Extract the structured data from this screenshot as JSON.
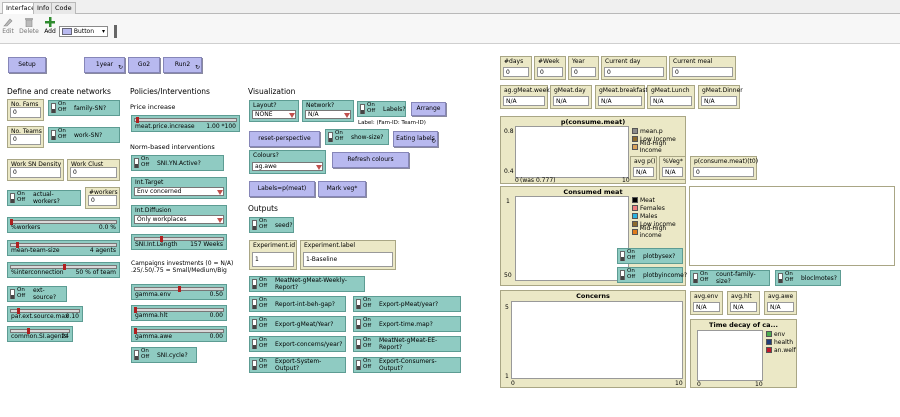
{
  "tabs": [
    "Interface",
    "Info",
    "Code"
  ],
  "toolbar": {
    "edit": "Edit",
    "delete": "Delete",
    "add": "Add",
    "widget_type": "Button"
  },
  "buttons": {
    "setup": "Setup",
    "one_year": "1year",
    "go2": "Go2",
    "run2": "Run2",
    "arrange": "Arrange",
    "reset_perspective": "reset-perspective",
    "eating_labels": "Eating labels",
    "refresh_colours": "Refresh colours",
    "labels_meat": "Labels=p(meat)",
    "mark_veg": "Mark veg*"
  },
  "sections": {
    "networks": "Define and create networks",
    "policies": "Policies/Interventions",
    "visualization": "Visualization",
    "outputs": "Outputs",
    "price_increase": "Price increase",
    "norm_based": "Norm-based interventions",
    "campaigns_line1": "Campaigns investments (0 = N/A)",
    "campaigns_line2": ".25/.50/.75 = Small/Medium/Big",
    "label_hint": "Label: (Fam-ID: Team-ID)"
  },
  "switches": {
    "family_sn": "family-SN?",
    "work_sn": "work-SN?",
    "actual_workers": "actual-workers?",
    "ext_source": "ext-source?",
    "sni_yn_active": "SNI.YN.Active?",
    "sni_cycle": "SNI.cycle?",
    "labels": "Labels?",
    "show_size": "show-size?",
    "seed": "seed?",
    "meatnet_weekly": "MeatNet-gMeat-Weekly-Report?",
    "report_int_beh_gap": "Report-int-beh-gap?",
    "export_gmeat_year": "Export-gMeat/Year?",
    "export_concerns_year": "Export-concerns/year?",
    "export_system_output": "Export-System-Output?",
    "export_pmeat_year": "Export-pMeat/year?",
    "export_time_map": "Export-time.map?",
    "meatnet_ee_report": "MeatNet-gMeat-EE-Report?",
    "export_consumers_output": "Export-Consumers-Output?",
    "plotbysex": "plotbysex?",
    "plotbyincome": "plotbyincome?",
    "count_family_size": "count-family-size?",
    "bloclmotes": "bloclmotes?",
    "on": "On",
    "off": "Off"
  },
  "inputs": {
    "no_fams": {
      "label": "No. Fams",
      "value": "0"
    },
    "no_teams": {
      "label": "No. Teams",
      "value": "0"
    },
    "work_sn_density": {
      "label": "Work SN Density",
      "value": "0"
    },
    "work_clust_coeff": {
      "label": "Work Clust Coeff",
      "value": "0"
    },
    "n_workers": {
      "label": "#workers",
      "value": "0"
    },
    "experiment_id": {
      "label": "Experiment.id",
      "value": "1"
    },
    "experiment_label": {
      "label": "Experiment.label",
      "value": "1-Baseline"
    }
  },
  "sliders": {
    "pct_workers": {
      "name": "%workers",
      "value": "0.0 %",
      "fraction": 0.0
    },
    "mean_team_size": {
      "name": "mean-team-size",
      "value": "4 agents",
      "fraction": 0.06
    },
    "pct_interconnection": {
      "name": "%interconnection",
      "value": "50 % of team",
      "fraction": 0.5
    },
    "par_ext_source_max": {
      "name": "par.ext.source.max",
      "value": "0.10",
      "fraction": 0.1
    },
    "common_si_agents": {
      "name": "common.SI.agents",
      "value": "24",
      "fraction": 0.3
    },
    "meat_price_increase": {
      "name": "meat.price.increase",
      "value": "1.00 *100",
      "fraction": 0.02
    },
    "sni_int_length": {
      "name": "SNI.Int.Length",
      "value": "157 Weeks",
      "fraction": 0.3
    },
    "gamma_env": {
      "name": "gamma.env",
      "value": "0.50",
      "fraction": 0.5
    },
    "gamma_hlt": {
      "name": "gamma.hlt",
      "value": "0.00",
      "fraction": 0.0
    },
    "gamma_awe": {
      "name": "gamma.awe",
      "value": "0.00",
      "fraction": 0.0
    }
  },
  "choosers": {
    "int_target": {
      "label": "Int.Target",
      "value": "Env concerned"
    },
    "int_diffusion": {
      "label": "Int.Diffusion",
      "value": "Only workplaces"
    },
    "layout": {
      "label": "Layout?",
      "value": "NONE"
    },
    "network": {
      "label": "Network?",
      "value": "N/A"
    },
    "colours": {
      "label": "Colours?",
      "value": "ag.awe"
    }
  },
  "monitors": {
    "days": {
      "label": "#days",
      "value": "0"
    },
    "week": {
      "label": "#Week",
      "value": "0"
    },
    "year": {
      "label": "Year",
      "value": "0"
    },
    "current_day": {
      "label": "Current day",
      "value": "0"
    },
    "current_meal": {
      "label": "Current meal",
      "value": "0"
    },
    "ag_gmeat_week": {
      "label": "ag.gMeat.week",
      "value": "N/A"
    },
    "gmeat_day": {
      "label": "gMeat.day",
      "value": "N/A"
    },
    "gmeat_breakfast": {
      "label": "gMeat.breakfast",
      "value": "N/A"
    },
    "gmeat_lunch": {
      "label": "gMeat.Lunch",
      "value": "N/A"
    },
    "gmeat_dinner": {
      "label": "gMeat.Dinner",
      "value": "N/A"
    },
    "avg_p": {
      "label": "avg p()",
      "value": "N/A"
    },
    "pct_veg": {
      "label": "%Veg*",
      "value": "N/A"
    },
    "p_consume_meat_t0": {
      "label": "p(consume.meat)(t0)",
      "value": "0"
    },
    "avg_env": {
      "label": "avg.env",
      "value": "N/A"
    },
    "avg_hlt": {
      "label": "avg.hlt",
      "value": "N/A"
    },
    "avg_awe": {
      "label": "avg.awe",
      "value": "N/A"
    }
  },
  "plots": {
    "p_consume_meat": {
      "title": "p(consume.meat)",
      "ymax": "0.8",
      "ymin": "0.4",
      "xmin": "0",
      "xmin_note": "(was 0.777)",
      "xmax": "10",
      "legend": [
        {
          "name": "mean.p",
          "color": "#8c8c8c"
        },
        {
          "name": "Low Income",
          "color": "#8c6b2e"
        },
        {
          "name": "Mid-High Income",
          "color": "#d9a35a"
        }
      ]
    },
    "consumed_meat": {
      "title": "Consumed meat",
      "ymax": "1",
      "ymin": "50",
      "xmin": "0",
      "xmax": "10",
      "legend": [
        {
          "name": "Meat",
          "color": "#000000"
        },
        {
          "name": "Females",
          "color": "#f08080"
        },
        {
          "name": "Males",
          "color": "#2ab2e0"
        },
        {
          "name": "Low income",
          "color": "#8c6b2e"
        },
        {
          "name": "Mid-High income",
          "color": "#e07b1a"
        }
      ]
    },
    "concerns": {
      "title": "Concerns",
      "ymax": "5",
      "ymin": "1",
      "xmin": "0",
      "xmax": "10"
    },
    "time_decay": {
      "title": "Time decay of ca...",
      "xmin": "0",
      "xmax": "10",
      "legend": [
        {
          "name": "env",
          "color": "#4caf50"
        },
        {
          "name": "health",
          "color": "#1f3d7a"
        },
        {
          "name": "an.welf",
          "color": "#c0182b"
        }
      ]
    }
  }
}
